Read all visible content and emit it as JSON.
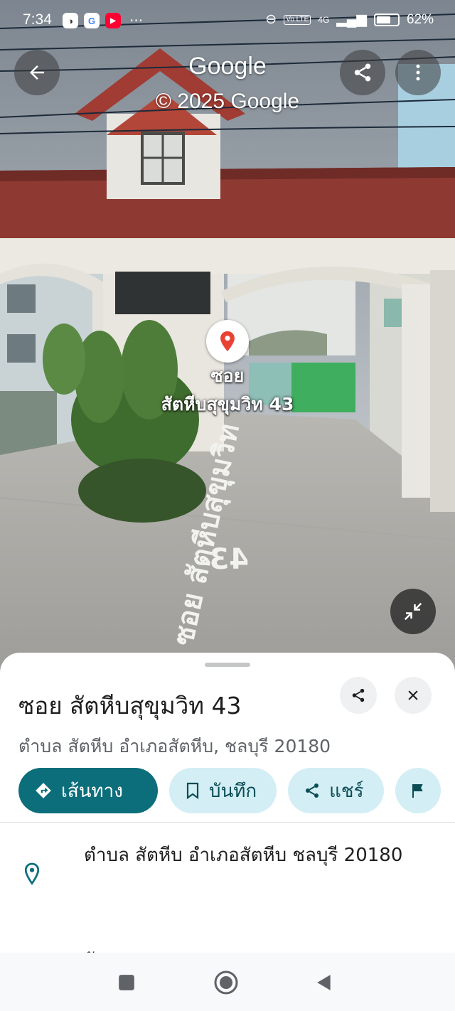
{
  "status_bar": {
    "time": "7:34",
    "battery": "62%",
    "network": "4G",
    "volte": "Vo LTE",
    "notif_google": "G",
    "more": "···"
  },
  "top_bar": {
    "title": "Google",
    "copyright": "© 2025 Google"
  },
  "pin": {
    "line1": "ซอย",
    "line2": "สัตหีบสุขุมวิท 43"
  },
  "road_marking": {
    "name": "ซอย สัตหีบสุขุมวิท",
    "number": "43"
  },
  "sheet": {
    "title": "ซอย สัตหีบสุขุมวิท 43",
    "subtitle": "ตำบล สัตหีบ อำเภอสัตหีบ, ชลบุรี 20180",
    "chips": [
      {
        "label": "เส้นทาง",
        "icon": "directions-icon"
      },
      {
        "label": "บันทึก",
        "icon": "bookmark-icon"
      },
      {
        "label": "แชร์",
        "icon": "share-icon"
      },
      {
        "label": "",
        "icon": "flag-icon"
      }
    ],
    "address": "ตำบล สัตหีบ อำเภอสัตหีบ ชลบุรี 20180",
    "next_row": "วัดระยะทาง"
  },
  "colors": {
    "primary": "#0b6e7a",
    "tonal": "#d3eef4",
    "pin": "#e94235"
  }
}
